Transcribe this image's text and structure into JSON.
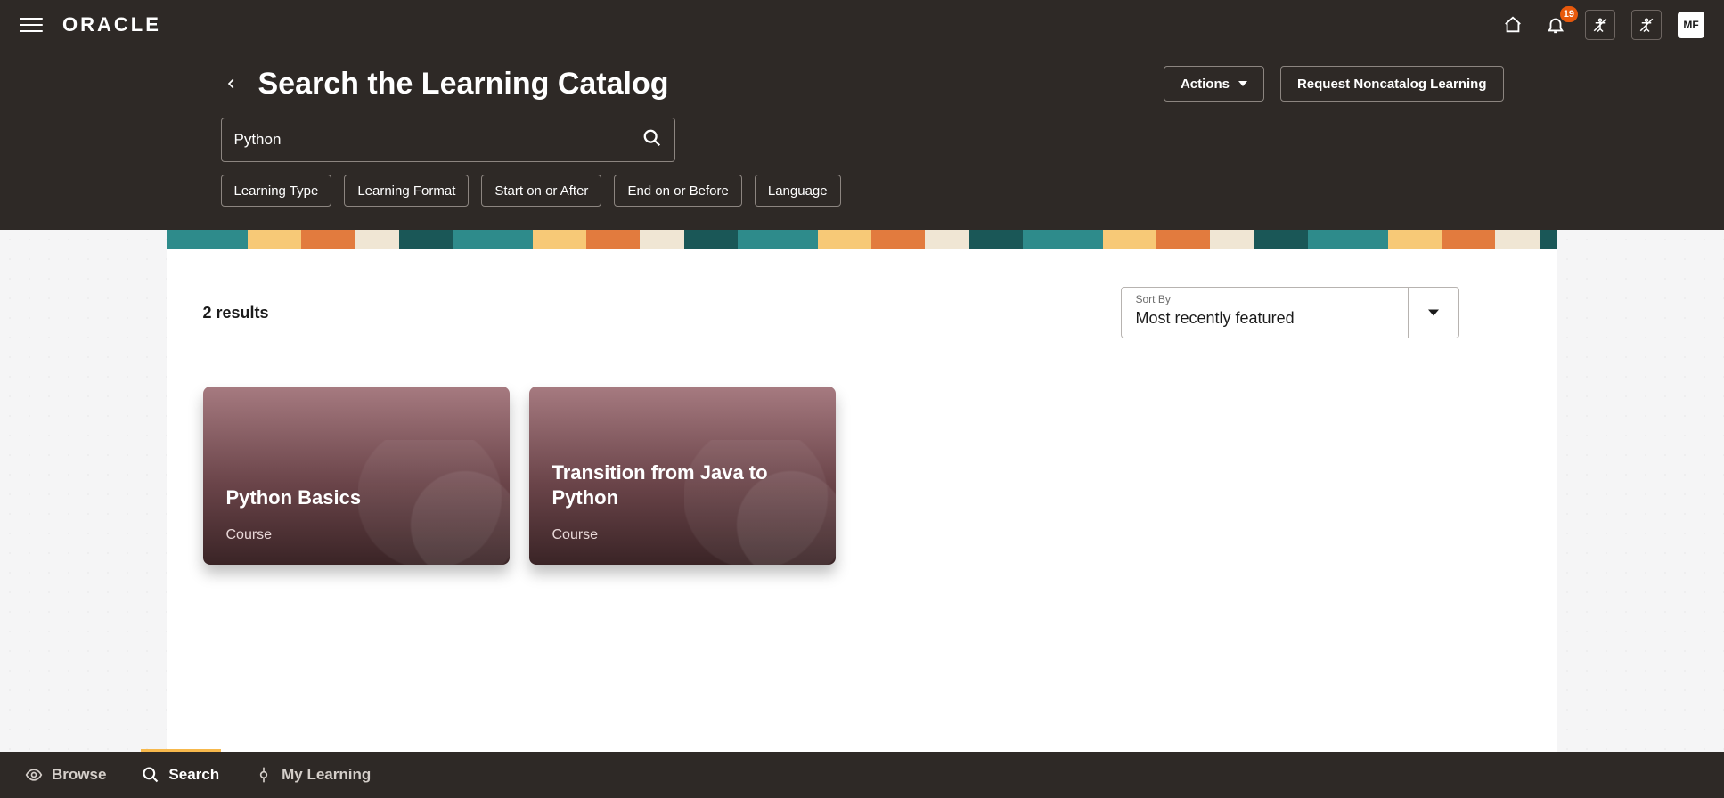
{
  "brand": "ORACLE",
  "notifications_count": "19",
  "avatar_initials": "MF",
  "page_title": "Search the Learning Catalog",
  "actions_label": "Actions",
  "request_label": "Request Noncatalog Learning",
  "search": {
    "value": "Python",
    "placeholder": ""
  },
  "filters": [
    "Learning Type",
    "Learning Format",
    "Start on or After",
    "End on or Before",
    "Language"
  ],
  "results_text": "2 results",
  "sort": {
    "label": "Sort By",
    "value": "Most recently featured"
  },
  "cards": [
    {
      "title": "Python Basics",
      "type": "Course"
    },
    {
      "title": "Transition from Java to Python",
      "type": "Course"
    }
  ],
  "bottom_nav": {
    "browse": "Browse",
    "search": "Search",
    "my_learning": "My Learning"
  }
}
